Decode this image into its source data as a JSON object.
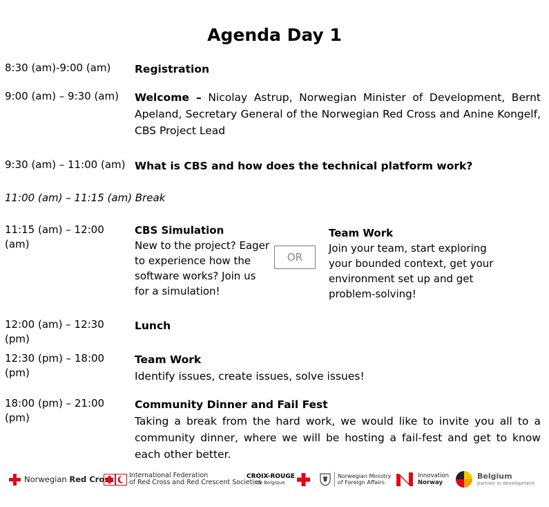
{
  "title": "Agenda Day 1",
  "items": [
    {
      "time": "8:30 (am)-9:00 (am)",
      "bold": "Registration",
      "text": ""
    },
    {
      "time": "9:00 (am) – 9:30 (am)",
      "bold": "Welcome –",
      "text": " Nicolay Astrup, Norwegian Minister of Development, Bernt Apeland, Secretary General of the Norwegian Red Cross and Anine Kongelf, CBS Project Lead"
    },
    {
      "time": "9:30 (am) – 11:00 (am)",
      "bold": "What is CBS and how does the technical platform work?",
      "text": ""
    },
    {
      "time": "11:00 (am) – 11:15 (am) Break"
    },
    {
      "time": "11:15 (am) – 12:00 (am)"
    },
    {
      "time": "12:00 (am) – 12:30 (pm)",
      "bold": "Lunch",
      "text": ""
    },
    {
      "time": "12:30 (pm) – 18:00 (pm)",
      "bold": "Team Work",
      "text": "Identify issues, create issues, solve issues!"
    },
    {
      "time": "18:00 (pm) – 21:00 (pm)",
      "bold": "Community Dinner and Fail Fest",
      "text": "Taking a break from the hard work, we would like to invite you all to a community dinner, where we will be hosting a fail-fest and get to know each other better."
    }
  ],
  "session_1115": {
    "left_title": "CBS Simulation",
    "left_text": "New to the project? Eager to experience how the software works? Join us for a simulation!",
    "or_label": "OR",
    "right_title": "Team Work",
    "right_text": "Join your team, start exploring your bounded context, get your environment set up and get problem-solving!"
  },
  "logos": {
    "nrc": {
      "prefix": "Norwegian ",
      "bold": "Red Cross"
    },
    "ifrc": {
      "line1": "International Federation",
      "line2": "of Red Cross and Red Crescent Societies"
    },
    "croix_rouge": {
      "line1": "CROIX-ROUGE",
      "line2": "de Belgique"
    },
    "mfa": {
      "line1": "Norwegian Ministry",
      "line2": "of Foreign Affairs"
    },
    "innovation": {
      "line1": "Innovation",
      "line2": "Norway"
    },
    "belgium": {
      "line1": "Belgium",
      "line2": "partner in development"
    },
    "colors": {
      "red": "#e30613",
      "grey": "#555555"
    }
  }
}
